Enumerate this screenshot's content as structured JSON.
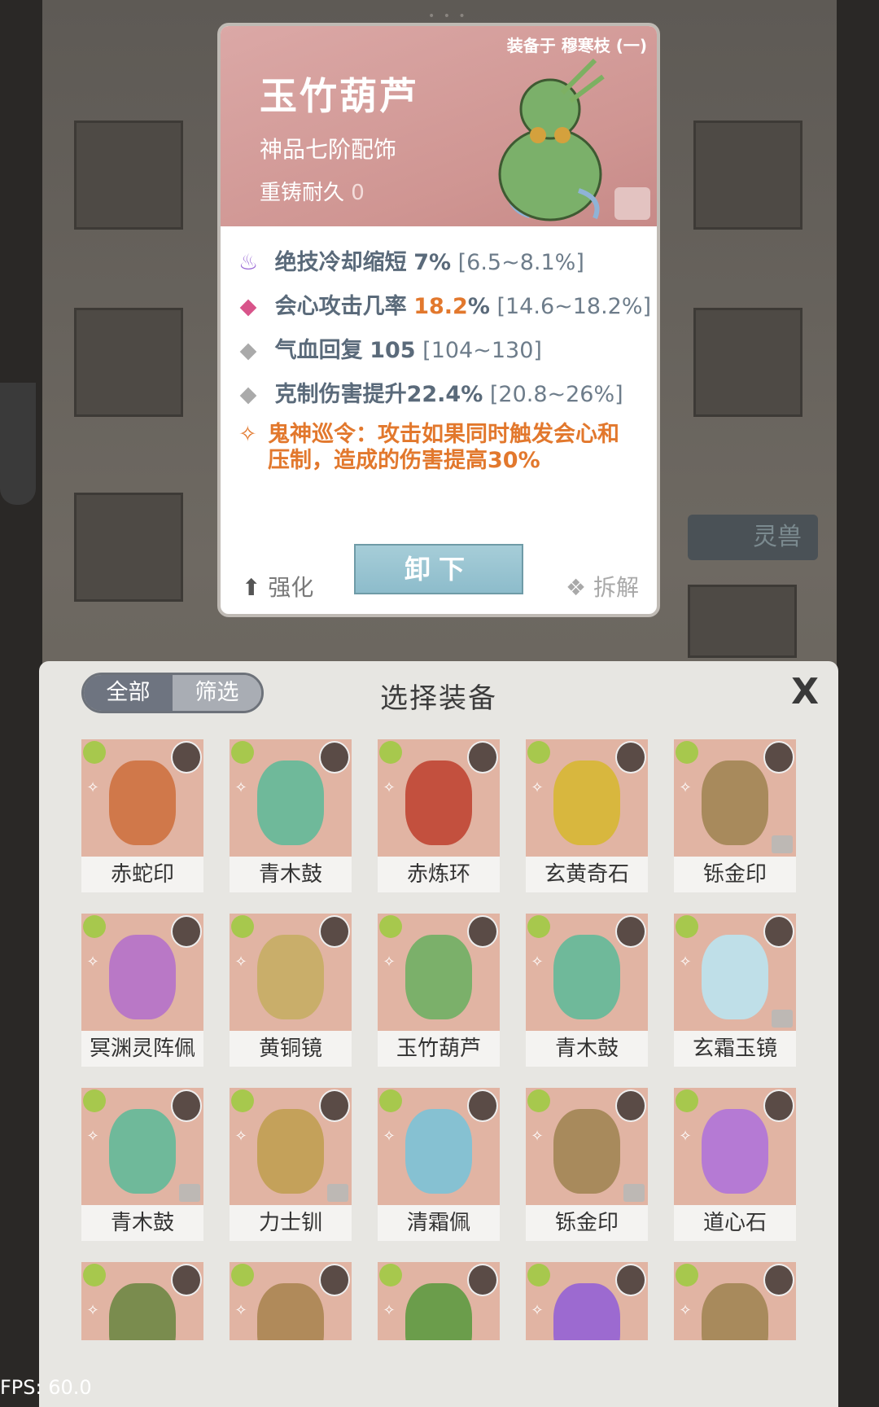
{
  "card": {
    "equipped_tag": "装备于 穆寒枝 (一)",
    "name": "玉竹葫芦",
    "rank": "神品七阶配饰",
    "durability_label": "重铸耐久",
    "durability_value": "0",
    "attributes": [
      {
        "icon": "cooldown-icon",
        "name": "绝技冷却缩短",
        "value": "7%",
        "range": "[6.5~8.1%]"
      },
      {
        "icon": "crit-diamond-icon",
        "name": "会心攻击几率",
        "value_hi": "18.2",
        "value_suffix": "%",
        "range": "[14.6~18.2%]"
      },
      {
        "icon": "diamond-icon",
        "name": "气血回复",
        "value": "105",
        "range": "[104~130]"
      },
      {
        "icon": "diamond-icon",
        "name": "克制伤害提升22.4%",
        "range": "[20.8~26%]"
      }
    ],
    "special_line1": "鬼神巡令：攻击如果同时触发会心和",
    "special_line2": "压制，造成的伤害提高30%",
    "unequip_label": "卸下",
    "enhance_label": "强化",
    "disassemble_label": "拆解"
  },
  "background": {
    "side_tag": "灵兽"
  },
  "panel": {
    "tab_all": "全部",
    "tab_filter": "筛选",
    "title": "选择装备",
    "close": "X",
    "items": [
      {
        "name": "赤蛇印",
        "color": "#d0784a",
        "locked": false
      },
      {
        "name": "青木鼓",
        "color": "#6fb99a",
        "locked": false
      },
      {
        "name": "赤炼环",
        "color": "#c3503e",
        "locked": false
      },
      {
        "name": "玄黄奇石",
        "color": "#d8b73e",
        "locked": false
      },
      {
        "name": "铄金印",
        "color": "#a88a5c",
        "locked": true
      },
      {
        "name": "冥渊灵阵佩",
        "color": "#b978c6",
        "locked": false
      },
      {
        "name": "黄铜镜",
        "color": "#c9ae6a",
        "locked": false
      },
      {
        "name": "玉竹葫芦",
        "color": "#7bb06a",
        "locked": false
      },
      {
        "name": "青木鼓",
        "color": "#6fb99a",
        "locked": false
      },
      {
        "name": "玄霜玉镜",
        "color": "#bfdfe8",
        "locked": true
      },
      {
        "name": "青木鼓",
        "color": "#6fb99a",
        "locked": true
      },
      {
        "name": "力士钏",
        "color": "#c4a15a",
        "locked": true
      },
      {
        "name": "清霜佩",
        "color": "#86c1d2",
        "locked": false
      },
      {
        "name": "铄金印",
        "color": "#a88a5c",
        "locked": true
      },
      {
        "name": "道心石",
        "color": "#b57ad4",
        "locked": false
      },
      {
        "name": "",
        "color": "#7a8c4e",
        "locked": false
      },
      {
        "name": "",
        "color": "#b08a5a",
        "locked": false
      },
      {
        "name": "",
        "color": "#6b9d4b",
        "locked": false
      },
      {
        "name": "",
        "color": "#9c6ad0",
        "locked": false
      },
      {
        "name": "",
        "color": "#a88a5c",
        "locked": false
      }
    ]
  },
  "fps": "FPS: 60.0"
}
